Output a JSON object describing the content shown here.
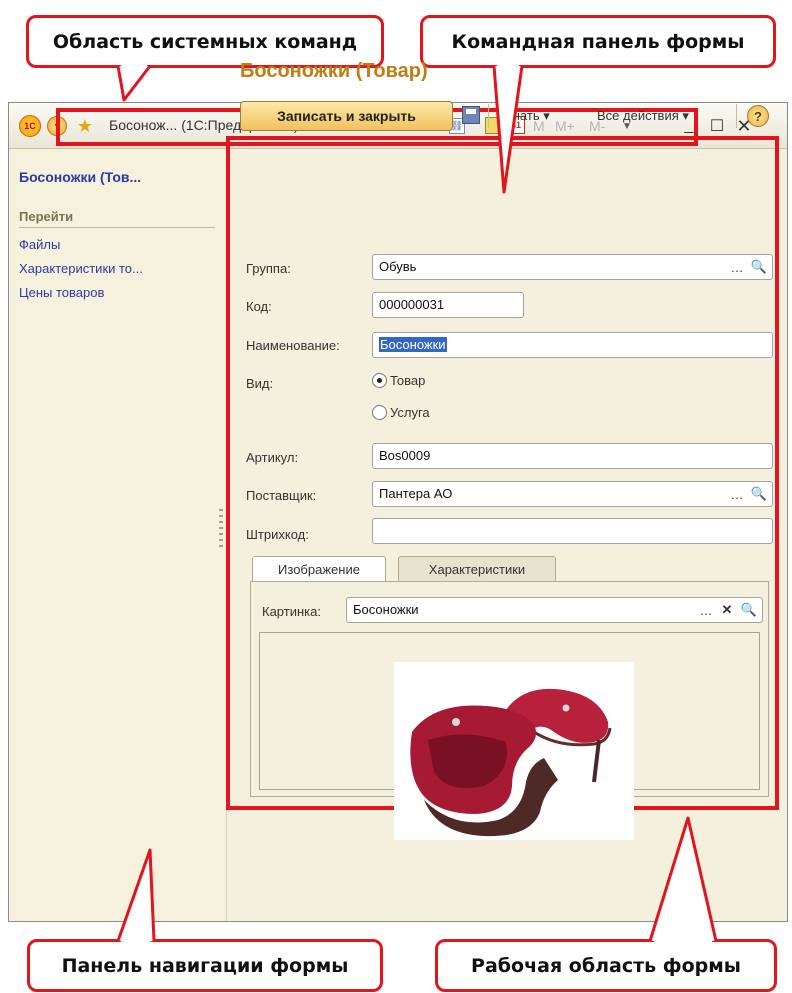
{
  "callouts": {
    "system": "Область системных команд",
    "command_panel": "Командная панель формы",
    "navigation": "Панель навигации формы",
    "workspace": "Рабочая область формы"
  },
  "titlebar": {
    "title": "Босонож... (1С:Предприятие)",
    "calendar_day": "31",
    "mem_m": "M",
    "mem_mplus": "M+",
    "mem_mminus": "M-",
    "min": "_",
    "max": "☐",
    "close": "✕"
  },
  "navigation": {
    "title": "Босоножки (Тов...",
    "goto_header": "Перейти",
    "links": [
      "Файлы",
      "Характеристики то...",
      "Цены товаров"
    ]
  },
  "form": {
    "title": "Босоножки (Товар)",
    "save_close": "Записать и закрыть",
    "print": "Печать ▾",
    "all_actions": "Все действия ▾",
    "help": "?"
  },
  "fields": {
    "group_label": "Группа:",
    "group_value": "Обувь",
    "code_label": "Код:",
    "code_value": "000000031",
    "name_label": "Наименование:",
    "name_value": "Босоножки",
    "kind_label": "Вид:",
    "kind_option_goods": "Товар",
    "kind_option_service": "Услуга",
    "kind_selected": "Товар",
    "article_label": "Артикул:",
    "article_value": "Bos0009",
    "supplier_label": "Поставщик:",
    "supplier_value": "Пантера АО",
    "barcode_label": "Штрихкод:",
    "barcode_value": ""
  },
  "tabs": [
    "Изображение",
    "Характеристики"
  ],
  "active_tab": "Изображение",
  "picture": {
    "label": "Картинка:",
    "value": "Босоножки"
  },
  "colors": {
    "highlight": "#e3141b",
    "accent_title": "#c07d12",
    "link": "#2b3aa8",
    "shoe": "#b8213c"
  }
}
